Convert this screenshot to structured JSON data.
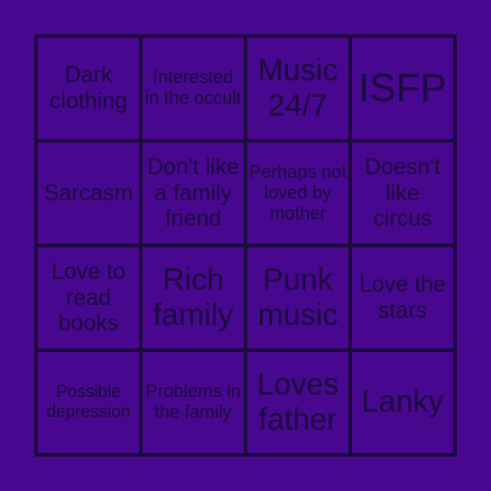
{
  "colors": {
    "background": "#47088f",
    "lines_text": "#1c0a3c"
  },
  "cells": [
    "Dark clothing",
    "Interested in the occult",
    "Music 24/7",
    "ISFP",
    "Sarcasm",
    "Don't like a family friend",
    "Perhaps not loved by mother",
    "Doesn't like circus",
    "Love to read books",
    "Rich family",
    "Punk music",
    "Love the stars",
    "Possible depression",
    "Problems in the family",
    "Loves father",
    "Lanky"
  ]
}
